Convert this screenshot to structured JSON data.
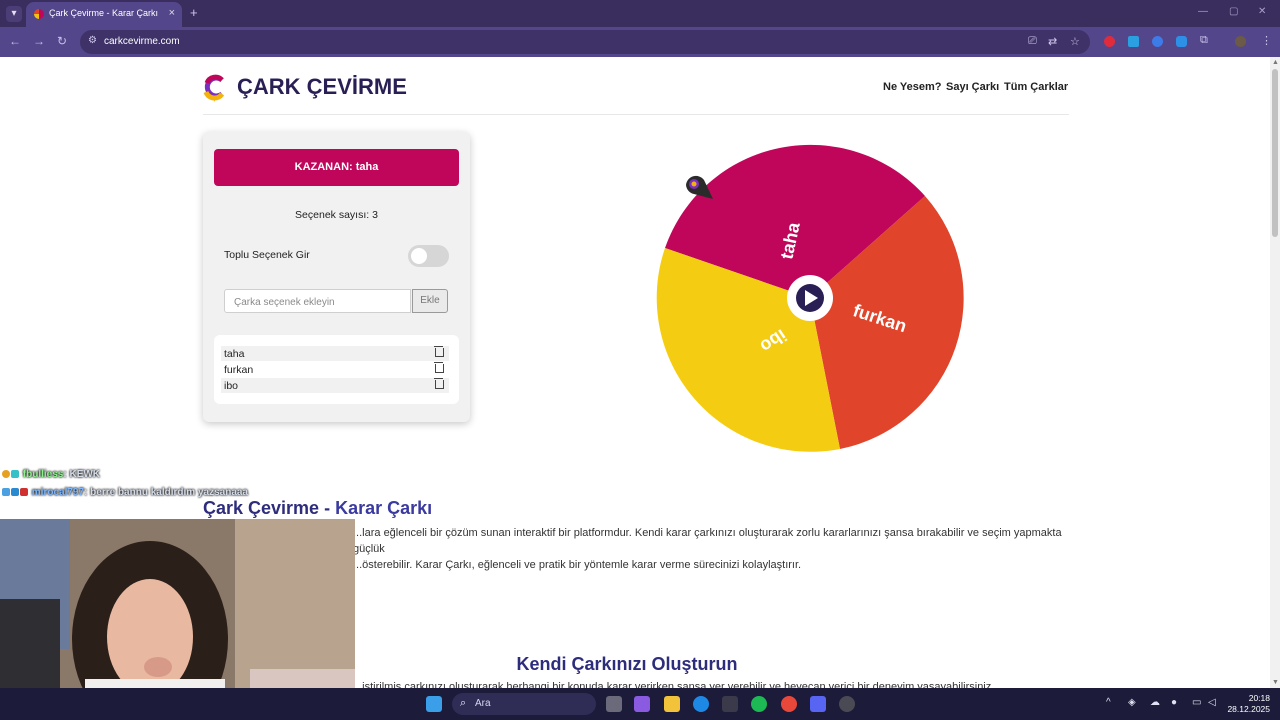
{
  "browser": {
    "tab_title": "Çark Çevirme - Karar Çarkı",
    "tab_close": "×",
    "new_tab": "+",
    "url": "carkcevirme.com"
  },
  "site": {
    "logo_text": "ÇARK ÇEVİRME",
    "nav": [
      "Ne Yesem?",
      "Sayı Çarkı",
      "Tüm Çarklar"
    ]
  },
  "panel": {
    "winner_label": "KAZANAN: taha",
    "option_count_label": "Seçenek sayısı: 3",
    "bulk_toggle_label": "Toplu Seçenek Gir",
    "bulk_toggle_on": false,
    "input_placeholder": "Çarka seçenek ekleyin",
    "add_button": "Ekle",
    "options": [
      "taha",
      "furkan",
      "ibo"
    ]
  },
  "wheel": {
    "segments": [
      {
        "label": "taha",
        "color": "#c0065a"
      },
      {
        "label": "furkan",
        "color": "#e0442a"
      },
      {
        "label": "ibo",
        "color": "#f4cd13"
      }
    ],
    "center_button": "play-icon"
  },
  "content": {
    "heading1_part1": "Çark Çevirme - ",
    "heading1_part2": "Karar Çarkı",
    "para1_line1": "...lara eğlenceli bir çözüm sunan interaktif bir platformdur. Kendi karar çarkınızı oluşturarak zorlu kararlarınızı şansa bırakabilir ve seçim yapmakta güçlük",
    "para1_line2": "...österebilir. Karar Çarkı, eğlenceli ve pratik bir yöntemle karar verme sürecinizi kolaylaştırır.",
    "heading2": "Kendi Çarkınızı Oluşturun",
    "para2": "...iştirilmiş çarkınızı oluşturarak herhangi bir konuda karar verirken şansa yer verebilir ve heyecan verici bir deneyim yaşayabilirsiniz."
  },
  "stream_chat": [
    {
      "user": "fbulliess",
      "message": ": KEWK"
    },
    {
      "user": "mirocal797",
      "message": ": berre bannu kaldırdım yazsanaaa"
    }
  ],
  "taskbar": {
    "search_label": "Ara",
    "time": "20:18",
    "date": "28.12.2025"
  },
  "colors": {
    "brand_dark": "#2a1f55",
    "winner_bg": "#c0065a",
    "heading": "#2e2d7c",
    "browser_frame": "#3a2e5f"
  }
}
